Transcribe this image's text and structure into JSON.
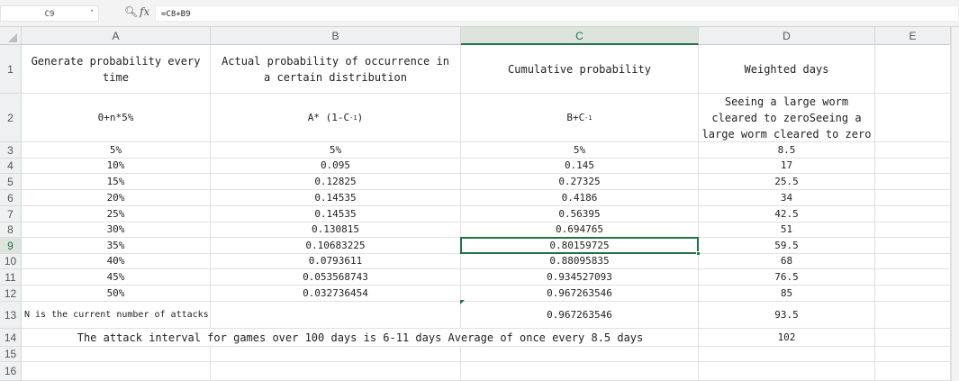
{
  "formula_bar": {
    "name_box": "C9",
    "zoom_icon": "zoom-lookup-icon",
    "fx_label": "fx",
    "formula": "=C8+B9"
  },
  "columns": [
    "A",
    "B",
    "C",
    "D",
    "E"
  ],
  "rows": [
    "1",
    "2",
    "3",
    "4",
    "5",
    "6",
    "7",
    "8",
    "9",
    "10",
    "11",
    "12",
    "13",
    "14",
    "15",
    "16"
  ],
  "selected": {
    "column": "C",
    "row": "9"
  },
  "headers": {
    "a1": "Generate probability every time",
    "b1": "Actual probability of occurrence in a certain distribution",
    "c1": "Cumulative probability",
    "d1": "Weighted days"
  },
  "formulas": {
    "a2": "0+n*5%",
    "b2_base": "A* (1-C",
    "b2_exp": "-1",
    "b2_close": ")",
    "c2_base": "B+C",
    "c2_exp": "-1",
    "d2": "Seeing a large worm cleared to zeroSeeing a large worm cleared to zero"
  },
  "table": [
    {
      "a": "5%",
      "b": "5%",
      "c": "5%",
      "d": "8.5"
    },
    {
      "a": "10%",
      "b": "0.095",
      "c": "0.145",
      "d": "17"
    },
    {
      "a": "15%",
      "b": "0.12825",
      "c": "0.27325",
      "d": "25.5"
    },
    {
      "a": "20%",
      "b": "0.14535",
      "c": "0.4186",
      "d": "34"
    },
    {
      "a": "25%",
      "b": "0.14535",
      "c": "0.56395",
      "d": "42.5"
    },
    {
      "a": "30%",
      "b": "0.130815",
      "c": "0.694765",
      "d": "51"
    },
    {
      "a": "35%",
      "b": "0.10683225",
      "c": "0.80159725",
      "d": "59.5"
    },
    {
      "a": "40%",
      "b": "0.0793611",
      "c": "0.88095835",
      "d": "68"
    },
    {
      "a": "45%",
      "b": "0.053568743",
      "c": "0.934527093",
      "d": "76.5"
    },
    {
      "a": "50%",
      "b": "0.032736454",
      "c": "0.967263546",
      "d": "85"
    }
  ],
  "row13": {
    "a": "N is the current number of attacks",
    "c": "0.967263546",
    "d": "93.5"
  },
  "row14": {
    "note": "The attack interval for games over 100 days is 6-11 days Average of once every 8.5 days",
    "d": "102"
  }
}
